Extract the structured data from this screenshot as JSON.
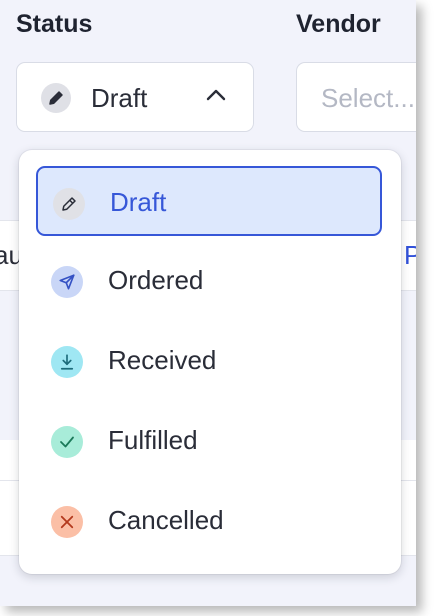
{
  "fields": {
    "status_label": "Status",
    "vendor_label": "Vendor",
    "status_value": "Draft",
    "vendor_placeholder": "Select..."
  },
  "background_table": {
    "partial_left_text": "au",
    "partial_right_text": "P"
  },
  "status_dropdown": {
    "selected": "Draft",
    "options": [
      {
        "label": "Draft",
        "icon": "pencil-icon",
        "color": "#e0e1e6",
        "icon_color": "#2a2d38"
      },
      {
        "label": "Ordered",
        "icon": "send-icon",
        "color": "#c9d6f7",
        "icon_color": "#3451c4"
      },
      {
        "label": "Received",
        "icon": "download-icon",
        "color": "#9fe7f3",
        "icon_color": "#1c6b7a"
      },
      {
        "label": "Fulfilled",
        "icon": "check-icon",
        "color": "#a8ecd9",
        "icon_color": "#1b7a5a"
      },
      {
        "label": "Cancelled",
        "icon": "x-icon",
        "color": "#fbbfa6",
        "icon_color": "#b3391d"
      }
    ]
  }
}
